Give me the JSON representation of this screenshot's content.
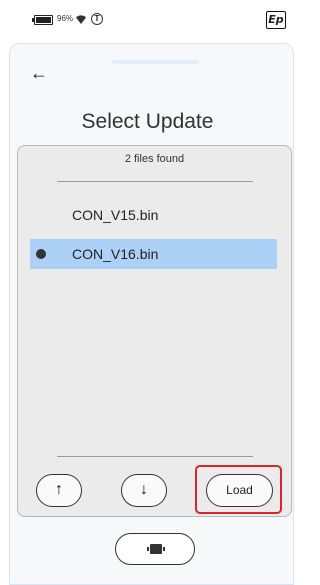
{
  "status_bar": {
    "battery_percent": "96%",
    "token_glyph": "T",
    "logo_text": "Ep",
    "icons": [
      "battery-icon",
      "wifi-icon",
      "token-icon",
      "ep-logo"
    ]
  },
  "header": {
    "back_arrow": "←",
    "title": "Select Update"
  },
  "file_list": {
    "count_text": "2 files found",
    "items": [
      {
        "name": "CON_V15.bin",
        "selected": false
      },
      {
        "name": "CON_V16.bin",
        "selected": true
      }
    ]
  },
  "controls": {
    "up_glyph": "↑",
    "down_glyph": "↓",
    "load_label": "Load",
    "bottom_button_icon": "connector-icon"
  },
  "colors": {
    "selected_row": "#add1f6",
    "highlight_border": "#d7262b",
    "list_background": "#ebebeb"
  }
}
